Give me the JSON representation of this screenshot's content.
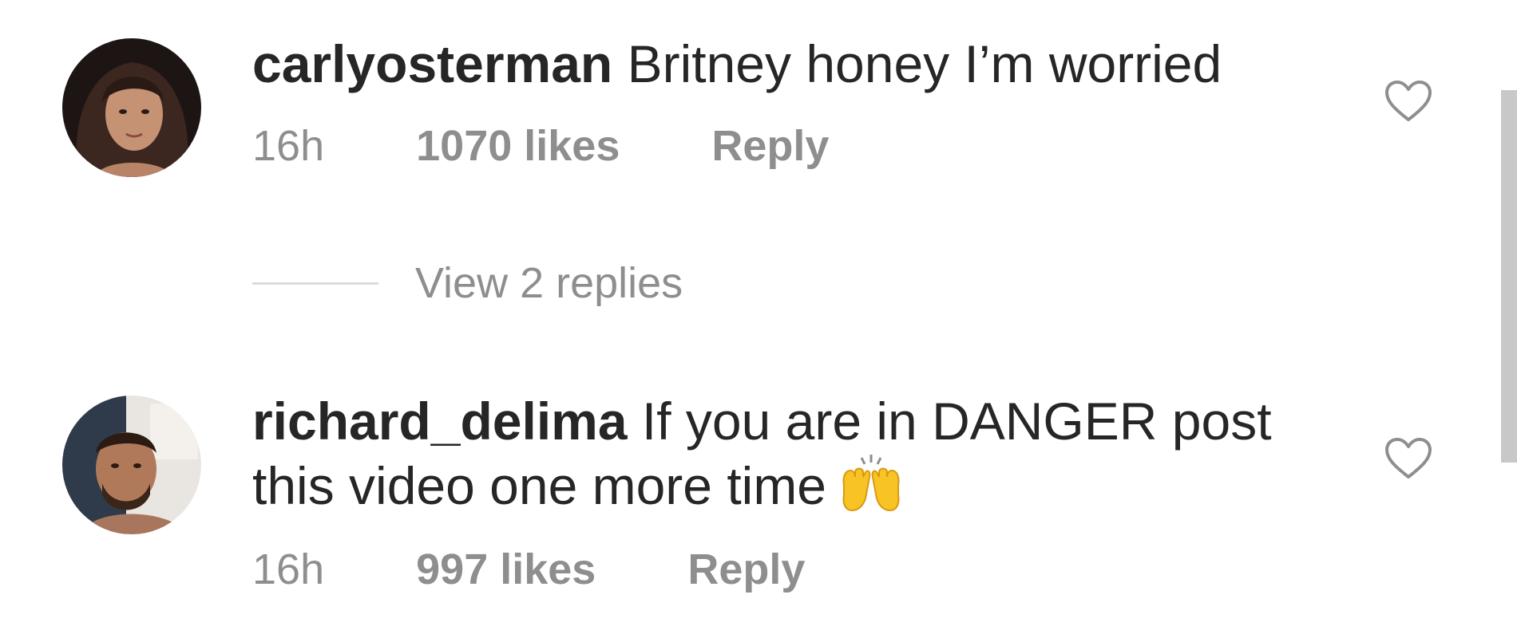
{
  "comments": [
    {
      "username": "carlyosterman",
      "text": "Britney honey I’m worried",
      "emoji": "",
      "time": "16h",
      "likes": "1070 likes",
      "reply_label": "Reply",
      "liked": false
    },
    {
      "username": "richard_delima",
      "text": "If you are in DANGER post this video one more time",
      "emoji": "raising-hands-emoji",
      "time": "16h",
      "likes": "997 likes",
      "reply_label": "Reply",
      "liked": false
    }
  ],
  "view_replies": {
    "label": "View 2 replies"
  },
  "icons": {
    "like": "heart-outline-icon"
  },
  "colors": {
    "text_primary": "#262626",
    "text_secondary": "#8e8e8e",
    "divider": "#dbdbdb",
    "scrollbar": "#c8c8c8",
    "emoji_yellow": "#f7c325"
  }
}
